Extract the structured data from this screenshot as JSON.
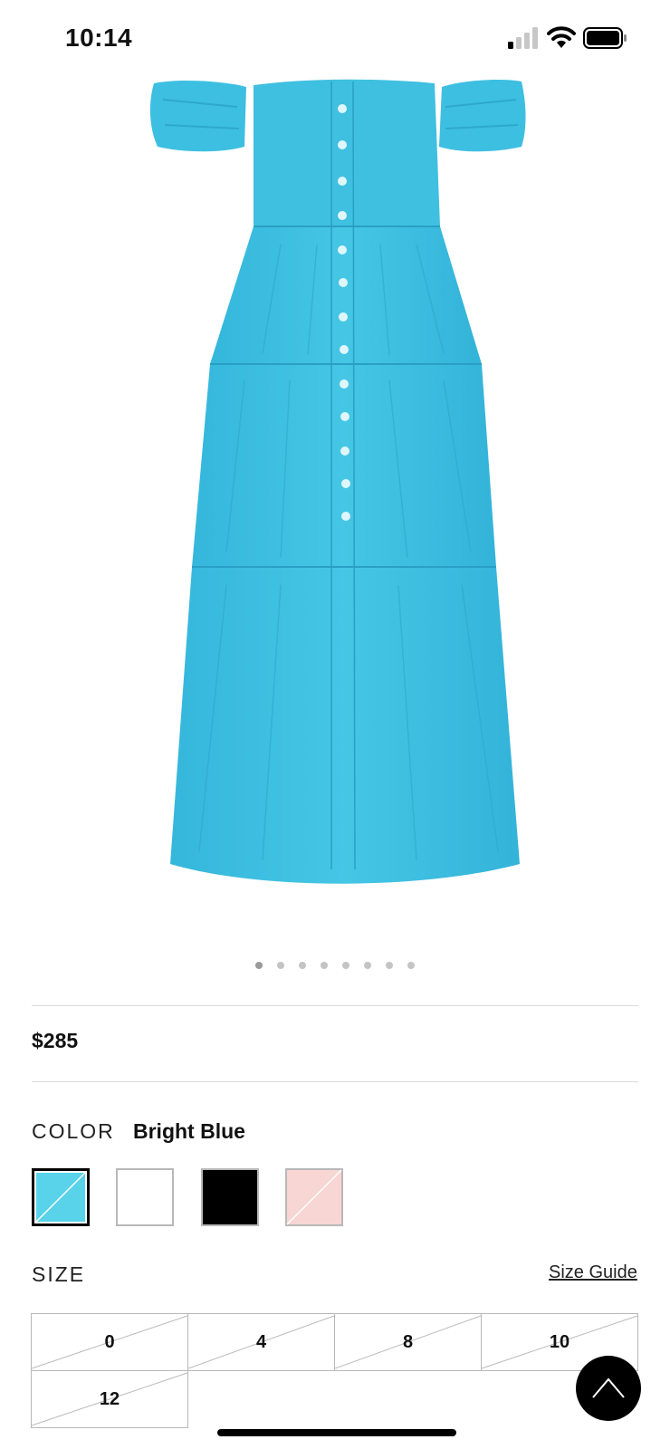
{
  "status_bar": {
    "time": "10:14",
    "icons": [
      "cellular-signal-icon",
      "wifi-icon",
      "battery-icon"
    ]
  },
  "product": {
    "image": "bright-blue-tiered-off-shoulder-midi-dress",
    "carousel": {
      "total_images": 8,
      "current_index": 1
    },
    "price": "$285",
    "color": {
      "label": "COLOR",
      "selected": "Bright Blue",
      "swatches": [
        {
          "name": "Bright Blue",
          "color": "#58d3ea",
          "unavailable": true,
          "selected": true
        },
        {
          "name": "White",
          "color": "#ffffff",
          "unavailable": false,
          "selected": false
        },
        {
          "name": "Black",
          "color": "#000000",
          "unavailable": false,
          "selected": false
        },
        {
          "name": "Pink",
          "color": "#f7d6d3",
          "unavailable": true,
          "selected": false
        }
      ]
    },
    "size": {
      "label": "SIZE",
      "guide_link": "Size Guide",
      "options": [
        {
          "label": "0",
          "unavailable": true
        },
        {
          "label": "4",
          "unavailable": true
        },
        {
          "label": "8",
          "unavailable": true
        },
        {
          "label": "10",
          "unavailable": true
        },
        {
          "label": "12",
          "unavailable": true
        }
      ]
    }
  },
  "colors": {
    "dress": "#3fc0e0",
    "dress_shadow": "#2aa6cc",
    "divider": "#dcdcdc",
    "text": "#111111"
  },
  "icons": {
    "scroll_top": "chevron-up-icon"
  }
}
